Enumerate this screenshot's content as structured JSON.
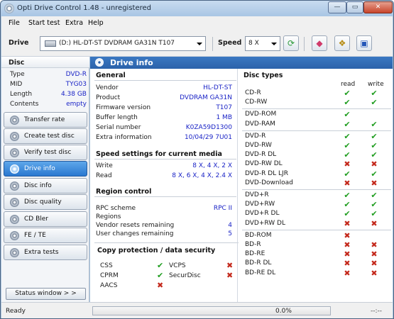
{
  "window": {
    "title": "Opti Drive Control 1.48 - unregistered",
    "controls": {
      "minimize": "—",
      "maximize": "▭",
      "close": "✕"
    }
  },
  "menu": {
    "items": [
      "File",
      "Start test",
      "Extra",
      "Help"
    ]
  },
  "toolbar": {
    "drive_label": "Drive",
    "drive_value": "(D:)  HL-DT-ST DVDRAM GA31N T107",
    "speed_label": "Speed",
    "speed_value": "8 X",
    "buttons": [
      "refresh-icon",
      "eraser-icon",
      "disc-tools-icon",
      "save-icon"
    ]
  },
  "disc": {
    "header": "Disc",
    "rows": [
      {
        "key": "Type",
        "value": "DVD-R"
      },
      {
        "key": "MID",
        "value": "TYG03"
      },
      {
        "key": "Length",
        "value": "4.38 GB"
      },
      {
        "key": "Contents",
        "value": "empty"
      }
    ]
  },
  "nav": {
    "items": [
      {
        "label": "Transfer rate",
        "active": false
      },
      {
        "label": "Create test disc",
        "active": false
      },
      {
        "label": "Verify test disc",
        "active": false
      },
      {
        "label": "Drive info",
        "active": true
      },
      {
        "label": "Disc info",
        "active": false
      },
      {
        "label": "Disc quality",
        "active": false
      },
      {
        "label": "CD Bler",
        "active": false
      },
      {
        "label": "FE / TE",
        "active": false
      },
      {
        "label": "Extra tests",
        "active": false
      }
    ],
    "status_window_button": "Status window > >"
  },
  "panel": {
    "title": "Drive info",
    "general": {
      "title": "General",
      "rows": [
        {
          "key": "Vendor",
          "value": "HL-DT-ST"
        },
        {
          "key": "Product",
          "value": "DVDRAM GA31N"
        },
        {
          "key": "Firmware version",
          "value": "T107"
        },
        {
          "key": "Buffer length",
          "value": "1 MB"
        },
        {
          "key": "Serial number",
          "value": "K0ZA59D1300"
        },
        {
          "key": "Extra information",
          "value": "10/04/29 7U01"
        }
      ]
    },
    "speed_settings": {
      "title": "Speed settings for current media",
      "rows": [
        {
          "key": "Write",
          "value": "8 X, 4 X, 2 X"
        },
        {
          "key": "Read",
          "value": "8 X, 6 X, 4 X, 2.4 X"
        }
      ]
    },
    "region": {
      "title": "Region control",
      "rows": [
        {
          "key": "RPC scheme",
          "value": "RPC II"
        },
        {
          "key": "Regions",
          "value": ""
        },
        {
          "key": "Vendor resets remaining",
          "value": "4"
        },
        {
          "key": "User changes remaining",
          "value": "5"
        }
      ]
    },
    "copy_protection": {
      "title": "Copy protection / data security",
      "items": [
        {
          "name": "CSS",
          "supported": true
        },
        {
          "name": "CPRM",
          "supported": true
        },
        {
          "name": "AACS",
          "supported": false
        },
        {
          "name": "VCPS",
          "supported": false
        },
        {
          "name": "SecurDisc",
          "supported": false
        }
      ]
    },
    "disc_types": {
      "title": "Disc types",
      "read_header": "read",
      "write_header": "write",
      "groups": [
        [
          {
            "name": "CD-R",
            "read": true,
            "write": true
          },
          {
            "name": "CD-RW",
            "read": true,
            "write": true
          }
        ],
        [
          {
            "name": "DVD-ROM",
            "read": true,
            "write": null
          },
          {
            "name": "DVD-RAM",
            "read": true,
            "write": true
          }
        ],
        [
          {
            "name": "DVD-R",
            "read": true,
            "write": true
          },
          {
            "name": "DVD-RW",
            "read": true,
            "write": true
          },
          {
            "name": "DVD-R DL",
            "read": true,
            "write": true
          },
          {
            "name": "DVD-RW DL",
            "read": false,
            "write": false
          },
          {
            "name": "DVD-R DL LJR",
            "read": true,
            "write": true
          },
          {
            "name": "DVD-Download",
            "read": false,
            "write": false
          }
        ],
        [
          {
            "name": "DVD+R",
            "read": true,
            "write": true
          },
          {
            "name": "DVD+RW",
            "read": true,
            "write": true
          },
          {
            "name": "DVD+R DL",
            "read": true,
            "write": true
          },
          {
            "name": "DVD+RW DL",
            "read": false,
            "write": false
          }
        ],
        [
          {
            "name": "BD-ROM",
            "read": false,
            "write": null
          },
          {
            "name": "BD-R",
            "read": false,
            "write": false
          },
          {
            "name": "BD-RE",
            "read": false,
            "write": false
          },
          {
            "name": "BD-R DL",
            "read": false,
            "write": false
          },
          {
            "name": "BD-RE DL",
            "read": false,
            "write": false
          }
        ]
      ]
    }
  },
  "statusbar": {
    "status": "Ready",
    "progress_percent": 0,
    "progress_text": "0.0%",
    "time": "--:--"
  },
  "marks": {
    "check": "✔",
    "cross": "✖"
  }
}
